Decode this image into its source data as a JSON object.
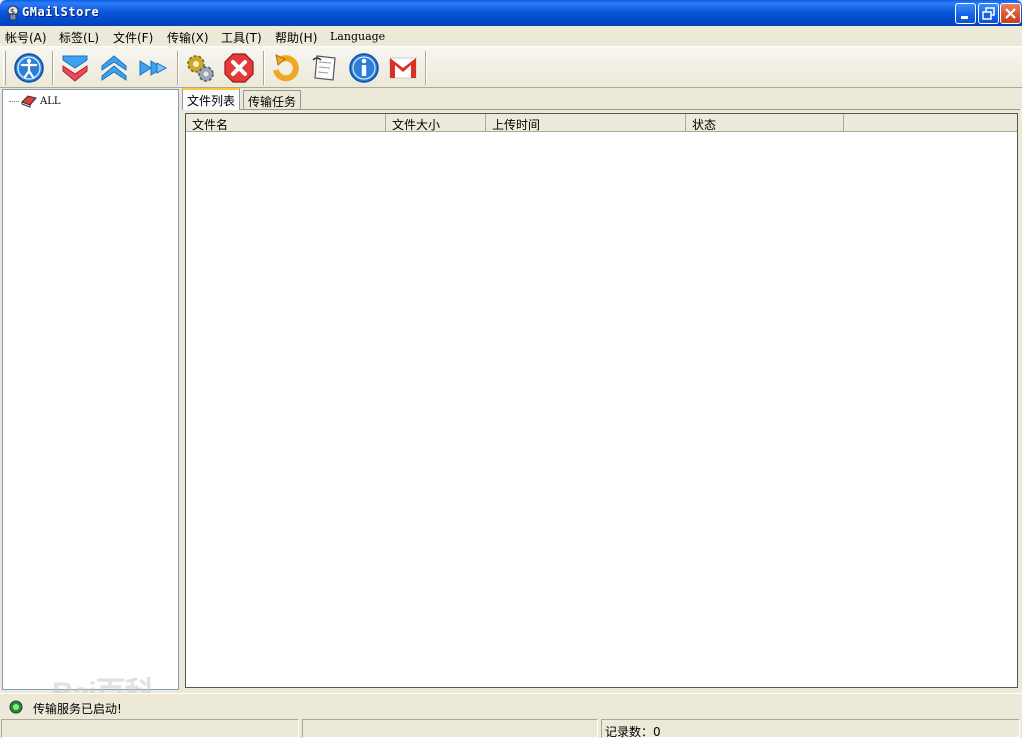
{
  "window": {
    "title": "GMailStore"
  },
  "menu": [
    {
      "label": "帐号(A)"
    },
    {
      "label": "标签(L)"
    },
    {
      "label": "文件(F)"
    },
    {
      "label": "传输(X)"
    },
    {
      "label": "工具(T)"
    },
    {
      "label": "帮助(H)"
    },
    {
      "label": "Language"
    }
  ],
  "toolbar": {
    "icons": [
      "account-icon",
      "download-icon",
      "upload-icon",
      "forward-icon",
      "settings-gears-icon",
      "stop-icon",
      "refresh-icon",
      "notes-icon",
      "info-icon",
      "gmail-icon"
    ]
  },
  "tree": {
    "root_label": "ALL"
  },
  "tabs": [
    {
      "label": "文件列表",
      "active": true
    },
    {
      "label": "传输任务",
      "active": false
    }
  ],
  "list": {
    "columns": [
      "文件名",
      "文件大小",
      "上传时间",
      "状态"
    ],
    "rows": []
  },
  "status": {
    "message": "传输服务已启动!",
    "records": "记录数：0"
  },
  "watermark": "Bai百科",
  "colors": {
    "titlebar": "#0b58dc",
    "chrome": "#ece9d8",
    "accent_tab": "#ffc83c"
  }
}
